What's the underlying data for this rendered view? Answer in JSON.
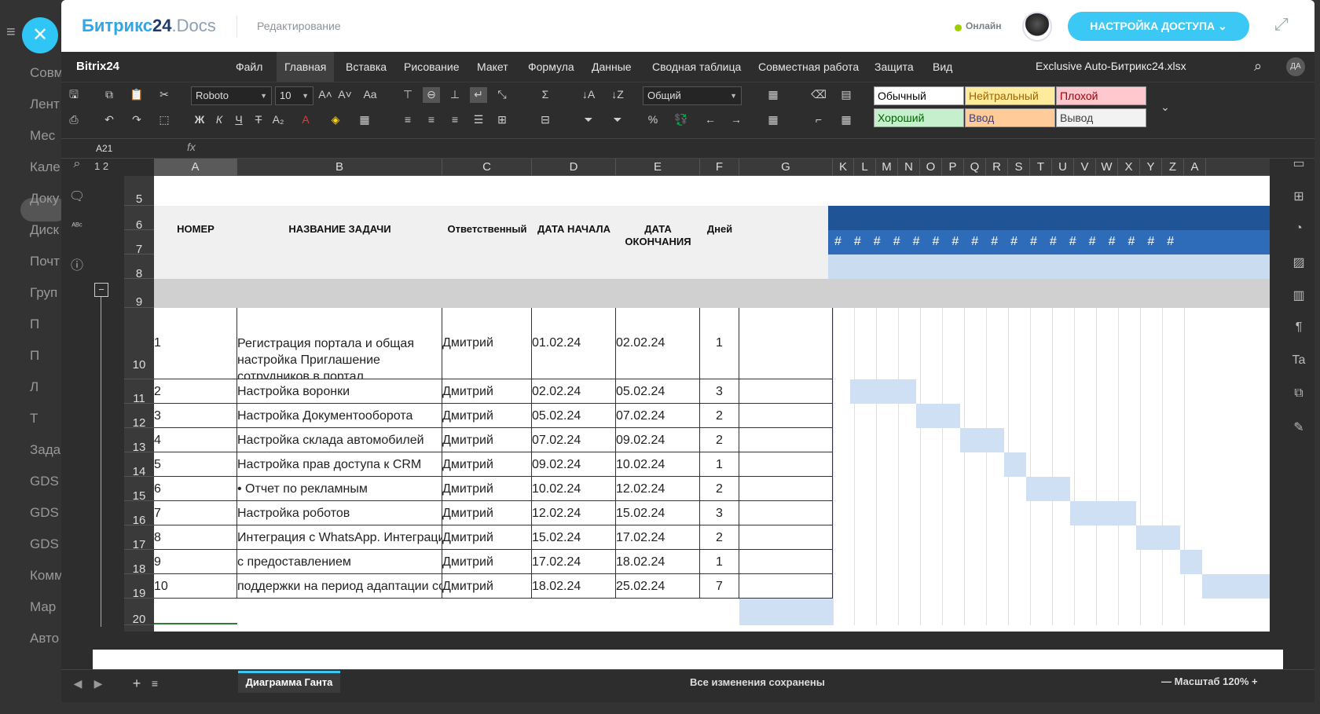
{
  "background": {
    "items": [
      "Совм",
      "Лент",
      "Мес",
      "Кале",
      "Доку",
      "Диск",
      "Почт",
      "Груп",
      "П",
      "П",
      "Л",
      "Т",
      "Зада",
      "GDS",
      "GDS",
      "GDS",
      "Комм",
      "Мар",
      "Авто"
    ]
  },
  "header": {
    "logo_part1": "Битрикс",
    "logo_part2": "24",
    "logo_part3": ".Docs",
    "mode": "Редактирование",
    "online": "Онлайн",
    "access_button": "НАСТРОЙКА ДОСТУПА"
  },
  "menubar": {
    "brand": "Bitrix24",
    "items": [
      "Файл",
      "Главная",
      "Вставка",
      "Рисование",
      "Макет",
      "Формула",
      "Данные",
      "Сводная таблица",
      "Совместная работа",
      "Защита",
      "Вид"
    ],
    "active": "Главная",
    "doc_title": "Exclusive Auto-Битрикс24.xlsx",
    "user_initials": "ДА"
  },
  "ribbon": {
    "font": "Roboto",
    "size": "10",
    "number_format": "Общий",
    "styles": [
      {
        "label": "Обычный",
        "bg": "#ffffff",
        "fg": "#000000"
      },
      {
        "label": "Нейтральный",
        "bg": "#ffeb9c",
        "fg": "#9c6500"
      },
      {
        "label": "Плохой",
        "bg": "#ffc7ce",
        "fg": "#9c0006"
      },
      {
        "label": "Хороший",
        "bg": "#c6efce",
        "fg": "#006100"
      },
      {
        "label": "Ввод",
        "bg": "#ffcc99",
        "fg": "#3f3f76"
      },
      {
        "label": "Вывод",
        "bg": "#f2f2f2",
        "fg": "#3f3f3f"
      }
    ]
  },
  "formula": {
    "cell_ref": "A21",
    "fx": "fx"
  },
  "grid": {
    "columns": [
      "A",
      "B",
      "C",
      "D",
      "E",
      "F",
      "G",
      "K",
      "L",
      "M",
      "N",
      "O",
      "P",
      "Q",
      "R",
      "S",
      "T",
      "U",
      "V",
      "W",
      "X",
      "Y",
      "Z",
      "A"
    ],
    "outline_levels": [
      "1",
      "2"
    ],
    "rows": [
      "5",
      "6",
      "7",
      "8",
      "9",
      "10",
      "11",
      "12",
      "13",
      "14",
      "15",
      "16",
      "17",
      "18",
      "19",
      "20"
    ],
    "headers": {
      "num": "НОМЕР",
      "task": "НАЗВАНИЕ ЗАДАЧИ",
      "resp": "Ответственный",
      "start": "ДАТА НАЧАЛА",
      "end": "ДАТА ОКОНЧАНИЯ",
      "days": "Дней"
    },
    "tasks": [
      {
        "n": "1",
        "name": "Регистрация портала и общая настройка Приглашение сотрудников в портал",
        "resp": "Дмитрий",
        "start": "01.02.24",
        "end": "02.02.24",
        "days": "1"
      },
      {
        "n": "2",
        "name": "Настройка воронки",
        "resp": "Дмитрий",
        "start": "02.02.24",
        "end": "05.02.24",
        "days": "3"
      },
      {
        "n": "3",
        "name": "Настройка Документооборота",
        "resp": "Дмитрий",
        "start": "05.02.24",
        "end": "07.02.24",
        "days": "2"
      },
      {
        "n": "4",
        "name": "Настройка склада автомобилей",
        "resp": "Дмитрий",
        "start": "07.02.24",
        "end": "09.02.24",
        "days": "2"
      },
      {
        "n": "5",
        "name": "Настройка прав доступа к CRM",
        "resp": "Дмитрий",
        "start": "09.02.24",
        "end": "10.02.24",
        "days": "1"
      },
      {
        "n": "6",
        "name": "• Отчет по рекламным",
        "resp": "Дмитрий",
        "start": "10.02.24",
        "end": "12.02.24",
        "days": "2"
      },
      {
        "n": "7",
        "name": "Настройка роботов",
        "resp": "Дмитрий",
        "start": "12.02.24",
        "end": "15.02.24",
        "days": "3"
      },
      {
        "n": "8",
        "name": "Интеграция с WhatsApp. Интеграция с сайтом",
        "resp": "Дмитрий",
        "start": "15.02.24",
        "end": "17.02.24",
        "days": "2"
      },
      {
        "n": "9",
        "name": "с предоставлением",
        "resp": "Дмитрий",
        "start": "17.02.24",
        "end": "18.02.24",
        "days": "1"
      },
      {
        "n": "10",
        "name": "поддержки на период адаптации сотрудников в",
        "resp": "Дмитрий",
        "start": "18.02.24",
        "end": "25.02.24",
        "days": "7"
      }
    ]
  },
  "status": {
    "sheet_tab": "Диаграмма Ганта",
    "saved": "Все изменения сохранены",
    "zoom": "Масштаб 120%"
  }
}
